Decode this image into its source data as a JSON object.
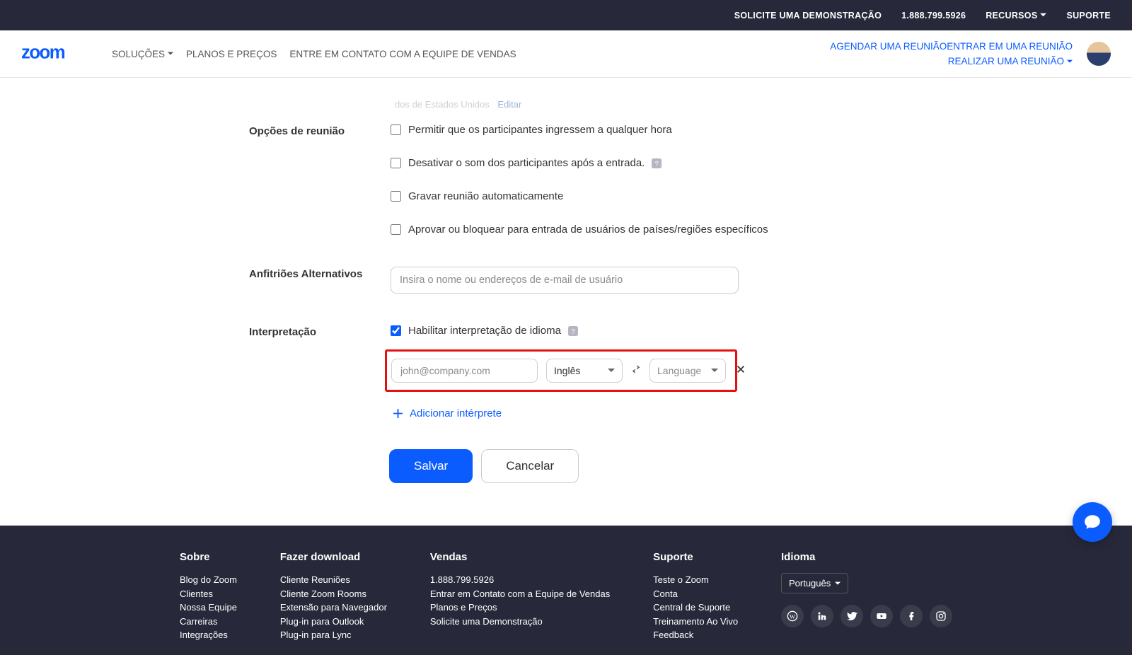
{
  "topbar": {
    "demo": "SOLICITE UMA DEMONSTRAÇÃO",
    "phone": "1.888.799.5926",
    "resources": "RECURSOS",
    "support": "SUPORTE"
  },
  "nav": {
    "solutions": "SOLUÇÕES",
    "plans": "PLANOS E PREÇOS",
    "contact_sales": "ENTRE EM CONTATO COM A EQUIPE DE VENDAS",
    "schedule": "AGENDAR UMA REUNIÃO",
    "join": "ENTRAR EM UMA REUNIÃO",
    "host": "REALIZAR UMA REUNIÃO"
  },
  "ghost": {
    "text": "dos de Estados Unidos",
    "edit": "Editar"
  },
  "form": {
    "opcoes_label": "Opções de reunião",
    "opt1": "Permitir que os participantes ingressem a qualquer hora",
    "opt2": "Desativar o som dos participantes após a entrada.",
    "opt3": "Gravar reunião automaticamente",
    "opt4": "Aprovar ou bloquear para entrada de usuários de países/regiões específicos",
    "alt_hosts_label": "Anfitriões Alternativos",
    "alt_hosts_placeholder": "Insira o nome ou endereços de e-mail de usuário",
    "interp_label": "Interpretação",
    "interp_enable": "Habilitar interpretação de idioma",
    "interp_email_placeholder": "john@company.com",
    "lang1": "Inglês",
    "lang2": "Language",
    "add_interp": "Adicionar intérprete",
    "save": "Salvar",
    "cancel": "Cancelar"
  },
  "footer": {
    "about_h": "Sobre",
    "about": [
      "Blog do Zoom",
      "Clientes",
      "Nossa Equipe",
      "Carreiras",
      "Integrações"
    ],
    "down_h": "Fazer download",
    "down": [
      "Cliente Reuniões",
      "Cliente Zoom Rooms",
      "Extensão para Navegador",
      "Plug-in para Outlook",
      "Plug-in para Lync"
    ],
    "sales_h": "Vendas",
    "sales": [
      "1.888.799.5926",
      "Entrar em Contato com a Equipe de Vendas",
      "Planos e Preços",
      "Solicite uma Demonstração"
    ],
    "support_h": "Suporte",
    "support": [
      "Teste o Zoom",
      "Conta",
      "Central de Suporte",
      "Treinamento Ao Vivo",
      "Feedback"
    ],
    "lang_h": "Idioma",
    "lang": "Português"
  }
}
